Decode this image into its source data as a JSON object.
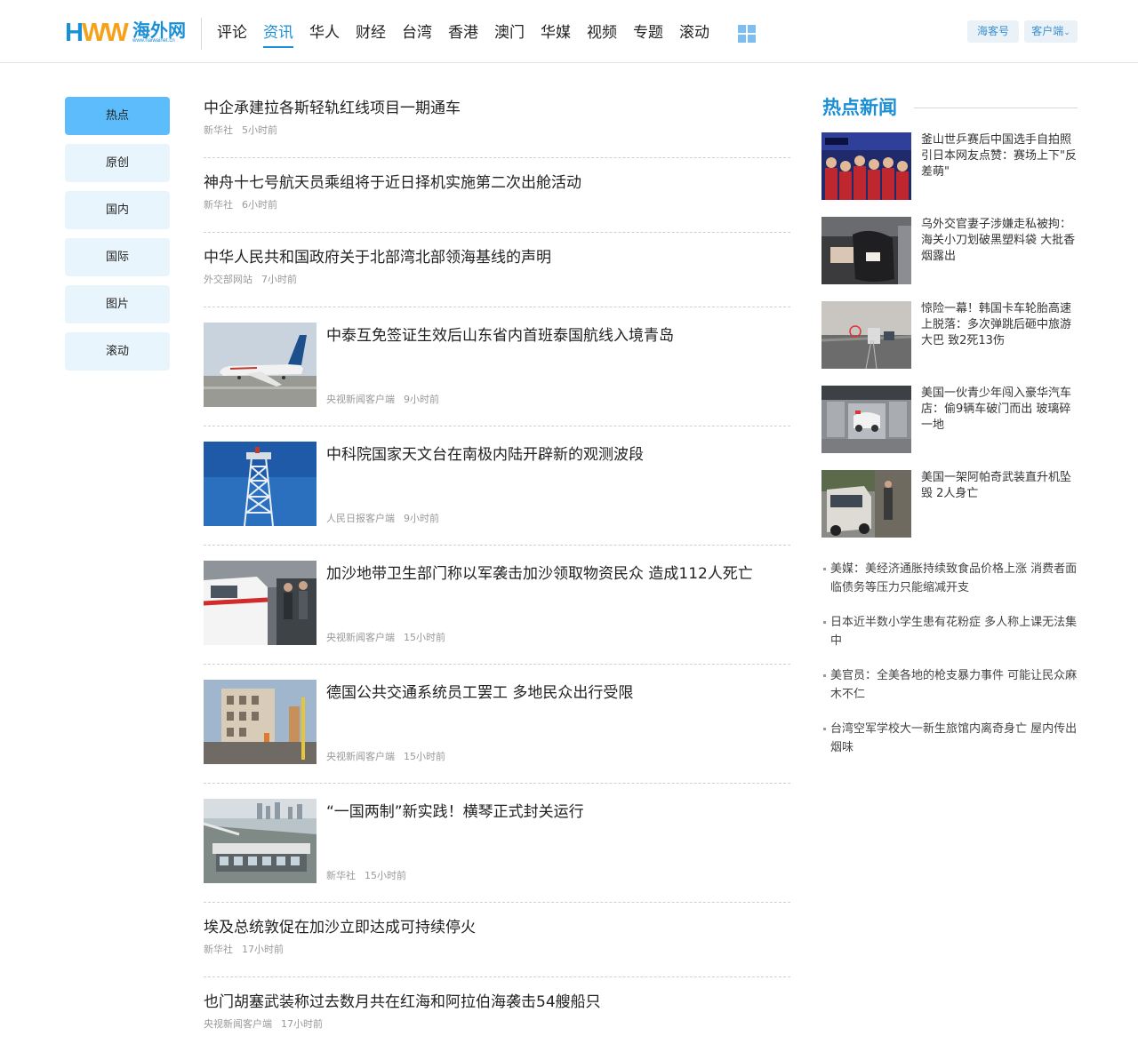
{
  "header": {
    "logo_text_h": "H",
    "logo_text_ww": "WW",
    "logo_cn": "海外网",
    "logo_url": "www.haiwainet.cn",
    "nav": [
      "评论",
      "资讯",
      "华人",
      "财经",
      "台湾",
      "香港",
      "澳门",
      "华媒",
      "视频",
      "专题",
      "滚动"
    ],
    "active_nav": "资讯",
    "btn_haike": "海客号",
    "btn_client": "客户端",
    "colors": {
      "brand_blue": "#1b8fd6",
      "brand_orange": "#f5a11a"
    }
  },
  "left_menu": {
    "items": [
      "热点",
      "原创",
      "国内",
      "国际",
      "图片",
      "滚动"
    ],
    "active": "热点"
  },
  "news": [
    {
      "title": "中企承建拉各斯轻轨红线项目一期通车",
      "source": "新华社",
      "time": "5小时前",
      "image": null
    },
    {
      "title": "神舟十七号航天员乘组将于近日择机实施第二次出舱活动",
      "source": "新华社",
      "time": "6小时前",
      "image": null
    },
    {
      "title": "中华人民共和国政府关于北部湾北部领海基线的声明",
      "source": "外交部网站",
      "time": "7小时前",
      "image": null
    },
    {
      "title": "中泰互免签证生效后山东省内首班泰国航线入境青岛",
      "source": "央视新闻客户端",
      "time": "9小时前",
      "image": "airplane"
    },
    {
      "title": "中科院国家天文台在南极内陆开辟新的观测波段",
      "source": "人民日报客户端",
      "time": "9小时前",
      "image": "tower"
    },
    {
      "title": "加沙地带卫生部门称以军袭击加沙领取物资民众 造成112人死亡",
      "source": "央视新闻客户端",
      "time": "15小时前",
      "image": "ambulance"
    },
    {
      "title": "德国公共交通系统员工罢工 多地民众出行受限",
      "source": "央视新闻客户端",
      "time": "15小时前",
      "image": "street"
    },
    {
      "title": "“一国两制”新实践！横琴正式封关运行",
      "source": "新华社",
      "time": "15小时前",
      "image": "port"
    },
    {
      "title": "埃及总统敦促在加沙立即达成可持续停火",
      "source": "新华社",
      "time": "17小时前",
      "image": null
    },
    {
      "title": "也门胡塞武装称过去数月共在红海和阿拉伯海袭击54艘船只",
      "source": "央视新闻客户端",
      "time": "17小时前",
      "image": null
    }
  ],
  "hot_news": {
    "title": "热点新闻",
    "items": [
      {
        "text": "釜山世乒赛后中国选手自拍照引日本网友点赞：赛场上下\"反差萌\"",
        "image": "players"
      },
      {
        "text": "乌外交官妻子涉嫌走私被拘：海关小刀划破黑塑料袋 大批香烟露出",
        "image": "cigarettes"
      },
      {
        "text": "惊险一幕！韩国卡车轮胎高速上脱落：多次弹跳后砸中旅游大巴 致2死13伤",
        "image": "highway"
      },
      {
        "text": "美国一伙青少年闯入豪华汽车店：偷9辆车破门而出 玻璃碎一地",
        "image": "cctv"
      },
      {
        "text": "美国一架阿帕奇武装直升机坠毁 2人身亡",
        "image": "truck"
      }
    ],
    "bullets": [
      "美媒：美经济通胀持续致食品价格上涨 消费者面临债务等压力只能缩减开支",
      "日本近半数小学生患有花粉症 多人称上课无法集中",
      "美官员：全美各地的枪支暴力事件 可能让民众麻木不仁",
      "台湾空军学校大一新生旅馆内离奇身亡 屋内传出烟味"
    ]
  }
}
